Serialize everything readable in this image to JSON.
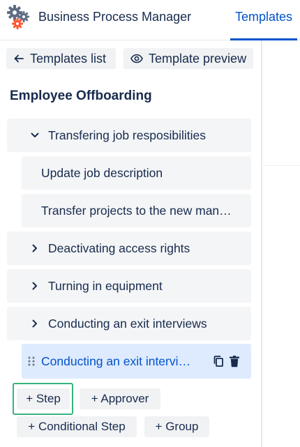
{
  "header": {
    "app_title": "Business Process Manager",
    "tabs": [
      {
        "label": "Templates",
        "active": true
      }
    ]
  },
  "toolbar": {
    "back_label": "Templates list",
    "preview_label": "Template preview"
  },
  "template": {
    "title": "Employee Offboarding",
    "groups": [
      {
        "label": "Transfering job resposibilities",
        "expanded": true
      },
      {
        "label": "Deactivating access rights",
        "expanded": false
      },
      {
        "label": "Turning in equipment",
        "expanded": false
      },
      {
        "label": "Conducting an exit interviews",
        "expanded": false
      }
    ],
    "steps": [
      {
        "label": "Update job description"
      },
      {
        "label": "Transfer projects to the new manager"
      }
    ],
    "selected_step": {
      "label": "Conducting an exit interviews"
    }
  },
  "add_buttons": {
    "step": "+ Step",
    "approver": "+ Approver",
    "conditional_step": "+ Conditional Step",
    "group": "+ Group"
  },
  "colors": {
    "accent": "#0052cc",
    "selected_bg": "#deebff",
    "row_bg": "#f4f5f7",
    "focus_ring": "#36b37e",
    "delete_icon": "#172b4d"
  }
}
